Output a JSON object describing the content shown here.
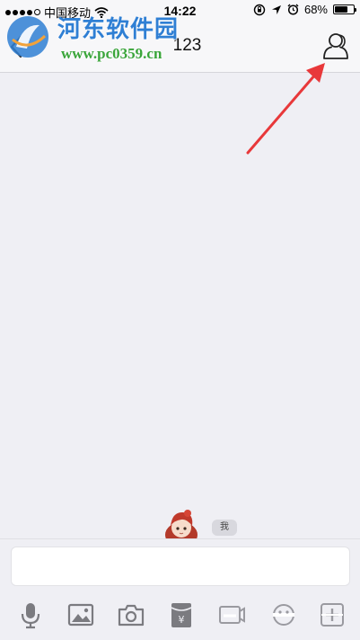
{
  "status_bar": {
    "carrier": "中国移动",
    "time": "14:22",
    "battery_percent_label": "68%",
    "battery_level": 0.68
  },
  "nav": {
    "title": "123"
  },
  "watermark": {
    "name": "河东软件园",
    "url": "www.pc0359.cn"
  },
  "chat": {
    "self_tag": "我"
  },
  "input": {
    "value": "",
    "placeholder": ""
  },
  "toolbar": {
    "icons": [
      "microphone-icon",
      "image-icon",
      "camera-icon",
      "red-packet-icon",
      "sticker-icon",
      "video-icon",
      "plus-icon"
    ]
  },
  "colors": {
    "accent_blue": "#2f7fd4",
    "watermark_green": "#3aa53a",
    "arrow_red": "#e8383a",
    "icon_gray": "#7b7b80",
    "chat_background": "#efeff4"
  }
}
